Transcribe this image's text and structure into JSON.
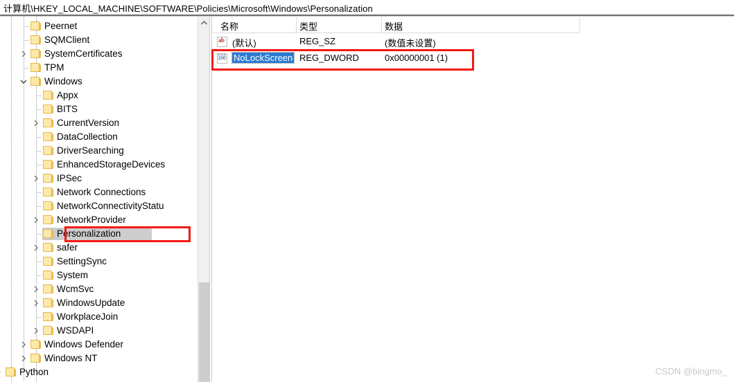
{
  "window": {
    "address_bar": {
      "path": "计算机\\HKEY_LOCAL_MACHINE\\SOFTWARE\\Policies\\Microsoft\\Windows\\Personalization"
    }
  },
  "tree": {
    "scrollbar": {
      "up_arrow": "▲"
    },
    "items": [
      {
        "label": "Peernet",
        "depth": 4,
        "expander": "none",
        "selected": false
      },
      {
        "label": "SQMClient",
        "depth": 4,
        "expander": "none",
        "selected": false
      },
      {
        "label": "SystemCertificates",
        "depth": 4,
        "expander": "collapsed",
        "selected": false
      },
      {
        "label": "TPM",
        "depth": 4,
        "expander": "none",
        "selected": false
      },
      {
        "label": "Windows",
        "depth": 4,
        "expander": "expanded",
        "selected": false
      },
      {
        "label": "Appx",
        "depth": 5,
        "expander": "none",
        "selected": false
      },
      {
        "label": "BITS",
        "depth": 5,
        "expander": "none",
        "selected": false
      },
      {
        "label": "CurrentVersion",
        "depth": 5,
        "expander": "collapsed",
        "selected": false
      },
      {
        "label": "DataCollection",
        "depth": 5,
        "expander": "none",
        "selected": false
      },
      {
        "label": "DriverSearching",
        "depth": 5,
        "expander": "none",
        "selected": false
      },
      {
        "label": "EnhancedStorageDevices",
        "depth": 5,
        "expander": "none",
        "selected": false
      },
      {
        "label": "IPSec",
        "depth": 5,
        "expander": "collapsed",
        "selected": false
      },
      {
        "label": "Network Connections",
        "depth": 5,
        "expander": "none",
        "selected": false
      },
      {
        "label": "NetworkConnectivityStatu",
        "depth": 5,
        "expander": "none",
        "selected": false
      },
      {
        "label": "NetworkProvider",
        "depth": 5,
        "expander": "collapsed",
        "selected": false
      },
      {
        "label": "Personalization",
        "depth": 5,
        "expander": "none",
        "selected": true
      },
      {
        "label": "safer",
        "depth": 5,
        "expander": "collapsed",
        "selected": false
      },
      {
        "label": "SettingSync",
        "depth": 5,
        "expander": "none",
        "selected": false
      },
      {
        "label": "System",
        "depth": 5,
        "expander": "none",
        "selected": false
      },
      {
        "label": "WcmSvc",
        "depth": 5,
        "expander": "collapsed",
        "selected": false
      },
      {
        "label": "WindowsUpdate",
        "depth": 5,
        "expander": "collapsed",
        "selected": false
      },
      {
        "label": "WorkplaceJoin",
        "depth": 5,
        "expander": "none",
        "selected": false
      },
      {
        "label": "WSDAPI",
        "depth": 5,
        "expander": "collapsed",
        "selected": false
      },
      {
        "label": "Windows Defender",
        "depth": 4,
        "expander": "collapsed",
        "selected": false
      },
      {
        "label": "Windows NT",
        "depth": 4,
        "expander": "collapsed",
        "selected": false
      },
      {
        "label": "Python",
        "depth": 2,
        "expander": "collapsed",
        "selected": false
      }
    ]
  },
  "values": {
    "columns": [
      "名称",
      "类型",
      "数据"
    ],
    "rows": [
      {
        "icon": "string-value-icon",
        "icon_text": "ab",
        "name": "(默认)",
        "type": "REG_SZ",
        "data": "(数值未设置)",
        "selected": false
      },
      {
        "icon": "dword-value-icon",
        "icon_text_top": "011",
        "icon_text_bottom": "100",
        "name": "NoLockScreen",
        "type": "REG_DWORD",
        "data": "0x00000001 (1)",
        "selected": true
      }
    ]
  },
  "annotations": {
    "highlight_color": "#f41a12",
    "tree_key_box": "Personalization",
    "value_row_box": "NoLockScreen"
  },
  "watermark": {
    "text": "CSDN @bingmo_"
  }
}
